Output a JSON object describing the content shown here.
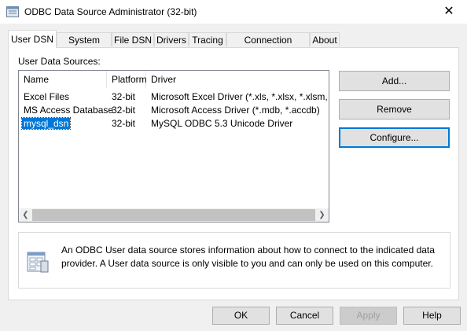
{
  "window": {
    "title": "ODBC Data Source Administrator (32-bit)",
    "close": "✕"
  },
  "tabs": [
    {
      "label": "User DSN",
      "active": true
    },
    {
      "label": "System DSN"
    },
    {
      "label": "File DSN"
    },
    {
      "label": "Drivers"
    },
    {
      "label": "Tracing"
    },
    {
      "label": "Connection Pooling"
    },
    {
      "label": "About"
    }
  ],
  "sources_label": "User Data Sources:",
  "columns": [
    "Name",
    "Platform",
    "Driver"
  ],
  "rows": [
    {
      "name": "Excel Files",
      "platform": "32-bit",
      "driver": "Microsoft Excel Driver (*.xls, *.xlsx, *.xlsm, *.xlsb)"
    },
    {
      "name": "MS Access Database",
      "platform": "32-bit",
      "driver": "Microsoft Access Driver (*.mdb, *.accdb)"
    },
    {
      "name": "mysql_dsn",
      "platform": "32-bit",
      "driver": "MySQL ODBC 5.3 Unicode Driver",
      "selected": true
    }
  ],
  "buttons": {
    "add": "Add...",
    "remove": "Remove",
    "configure": "Configure..."
  },
  "info_text": "An ODBC User data source stores information about how to connect to the indicated data provider.   A User data source is only visible to you and can only be used on this computer.",
  "footer": {
    "ok": "OK",
    "cancel": "Cancel",
    "apply": "Apply",
    "help": "Help"
  },
  "colors": {
    "selection": "#0078d7",
    "default_border": "#0078d7"
  }
}
